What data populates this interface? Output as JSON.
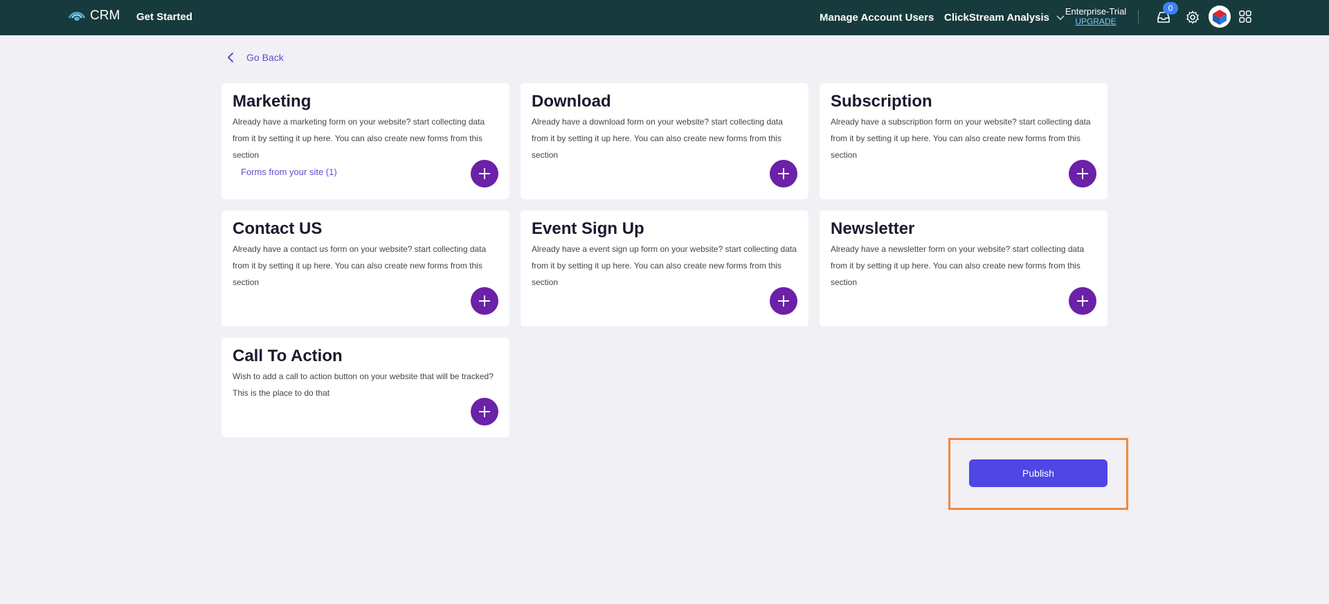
{
  "header": {
    "brand": "CRM",
    "get_started": "Get Started",
    "manage_users": "Manage Account Users",
    "clickstream": "ClickStream Analysis",
    "plan_name": "Enterprise-Trial",
    "plan_upgrade": "UPGRADE",
    "inbox_count": "0",
    "icons": {
      "logo": "crm-logo-icon",
      "inbox": "inbox-icon",
      "settings": "gear-icon",
      "avatar": "avatar",
      "apps": "apps-grid-icon"
    }
  },
  "go_back": "Go Back",
  "cards": [
    {
      "title": "Marketing",
      "description": "Already have a marketing form on your website? start collecting data from it by setting it up here. You can also create new forms from this section",
      "link": "Forms from your site (1)"
    },
    {
      "title": "Download",
      "description": "Already have a download form on your website? start collecting data from it by setting it up here. You can also create new forms from this section"
    },
    {
      "title": "Subscription",
      "description": "Already have a subscription form on your website? start collecting data from it by setting it up here. You can also create new forms from this section"
    },
    {
      "title": "Contact US",
      "description": "Already have a contact us form on your website? start collecting data from it by setting it up here. You can also create new forms from this section"
    },
    {
      "title": "Event Sign Up",
      "description": "Already have a event sign up form on your website? start collecting data from it by setting it up here. You can also create new forms from this section"
    },
    {
      "title": "Newsletter",
      "description": "Already have a newsletter form on your website? start collecting data from it by setting it up here. You can also create new forms from this section"
    },
    {
      "title": "Call To Action",
      "description": "Wish to add a call to action button on your website that will be tracked? This is the place to do that"
    }
  ],
  "publish_label": "Publish",
  "colors": {
    "topbar": "#173a3c",
    "accent_purple": "#6b21a8",
    "publish": "#4f46e5",
    "highlight": "#f0883e",
    "link": "#5a4fd6"
  }
}
